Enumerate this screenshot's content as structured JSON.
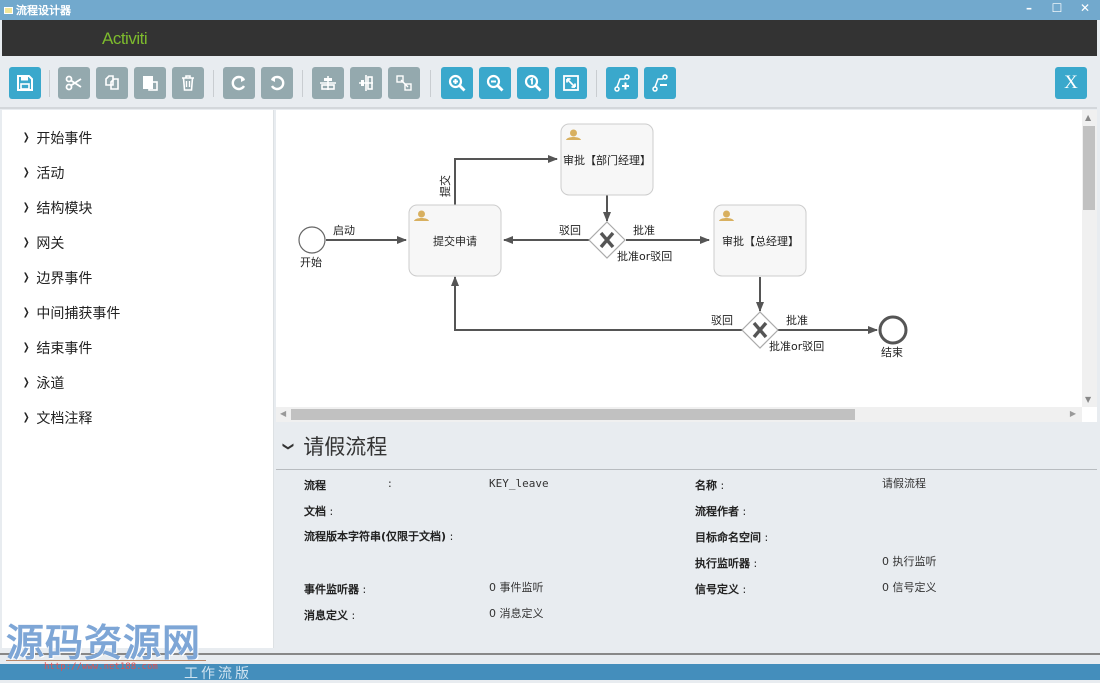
{
  "window": {
    "title": "流程设计器",
    "controls": {
      "minimize": "–",
      "maximize": "☐",
      "close": "✕"
    }
  },
  "header": {
    "logo": "Activiti"
  },
  "toolbar": {
    "buttons": [
      {
        "name": "save",
        "icon": "save-icon",
        "color": "blue"
      },
      {
        "name": "cut",
        "icon": "scissors-icon",
        "color": "grey"
      },
      {
        "name": "copy",
        "icon": "copy-icon",
        "color": "grey"
      },
      {
        "name": "paste",
        "icon": "paste-icon",
        "color": "grey"
      },
      {
        "name": "delete",
        "icon": "trash-icon",
        "color": "grey"
      },
      {
        "name": "redo",
        "icon": "redo-icon",
        "color": "grey"
      },
      {
        "name": "undo",
        "icon": "undo-icon",
        "color": "grey"
      },
      {
        "name": "align-horizontal",
        "icon": "align-horizontal-icon",
        "color": "grey"
      },
      {
        "name": "align-vertical",
        "icon": "align-vertical-icon",
        "color": "grey"
      },
      {
        "name": "same-size",
        "icon": "same-size-icon",
        "color": "grey"
      },
      {
        "name": "zoom-in",
        "icon": "zoom-in-icon",
        "color": "blue"
      },
      {
        "name": "zoom-out",
        "icon": "zoom-out-icon",
        "color": "blue"
      },
      {
        "name": "zoom-actual",
        "icon": "zoom-actual-icon",
        "color": "blue"
      },
      {
        "name": "zoom-fit",
        "icon": "zoom-fit-icon",
        "color": "blue"
      },
      {
        "name": "add-bendpoint",
        "icon": "add-bendpoint-icon",
        "color": "blue"
      },
      {
        "name": "remove-bendpoint",
        "icon": "remove-bendpoint-icon",
        "color": "blue"
      }
    ],
    "close_label": "X"
  },
  "colors": {
    "accent": "#3aa8cc",
    "disabled": "#94a9ae",
    "titlebar": "#72a9cd",
    "header": "#333333",
    "logo": "#7dbb2d",
    "user_icon": "#d8b060"
  },
  "sidebar": {
    "items": [
      {
        "label": "开始事件"
      },
      {
        "label": "活动"
      },
      {
        "label": "结构模块"
      },
      {
        "label": "网关"
      },
      {
        "label": "边界事件"
      },
      {
        "label": "中间捕获事件"
      },
      {
        "label": "结束事件"
      },
      {
        "label": "泳道"
      },
      {
        "label": "文档注释"
      }
    ]
  },
  "diagram": {
    "start_event": {
      "label": "开始"
    },
    "end_event": {
      "label": "结束"
    },
    "tasks": [
      {
        "id": "submit",
        "label": "提交申请"
      },
      {
        "id": "dept",
        "label": "审批【部门经理】"
      },
      {
        "id": "gm",
        "label": "审批【总经理】"
      }
    ],
    "gateways": [
      {
        "id": "gw1",
        "label": "批准or驳回"
      },
      {
        "id": "gw2",
        "label": "批准or驳回"
      }
    ],
    "flows": {
      "start_to_submit": "启动",
      "submit_to_dept": "提交",
      "gw1_reject": "驳回",
      "gw1_approve": "批准",
      "gw2_reject": "驳回",
      "gw2_approve": "批准"
    }
  },
  "properties": {
    "title": "请假流程",
    "left": [
      {
        "label": "流程",
        "sep": ":",
        "value": "KEY_leave"
      },
      {
        "label": "文档",
        "sep": ":",
        "value": ""
      },
      {
        "label": "流程版本字符串(仅限于文档)",
        "sep": ":",
        "value": ""
      },
      {
        "label": "事件监听器",
        "sep": ":",
        "value": "0 事件监听"
      },
      {
        "label": "消息定义",
        "sep": ":",
        "value": "0 消息定义"
      }
    ],
    "right": [
      {
        "label": "名称",
        "sep": ":",
        "value": "请假流程"
      },
      {
        "label": "流程作者",
        "sep": ":",
        "value": ""
      },
      {
        "label": "目标命名空间",
        "sep": ":",
        "value": ""
      },
      {
        "label": "执行监听器",
        "sep": ":",
        "value": "0 执行监听"
      },
      {
        "label": "信号定义",
        "sep": ":",
        "value": "0 信号定义"
      }
    ]
  },
  "footer": {
    "text": "工作流版"
  },
  "watermark": {
    "text": "源码资源网",
    "url": "http://www.net188.com"
  }
}
